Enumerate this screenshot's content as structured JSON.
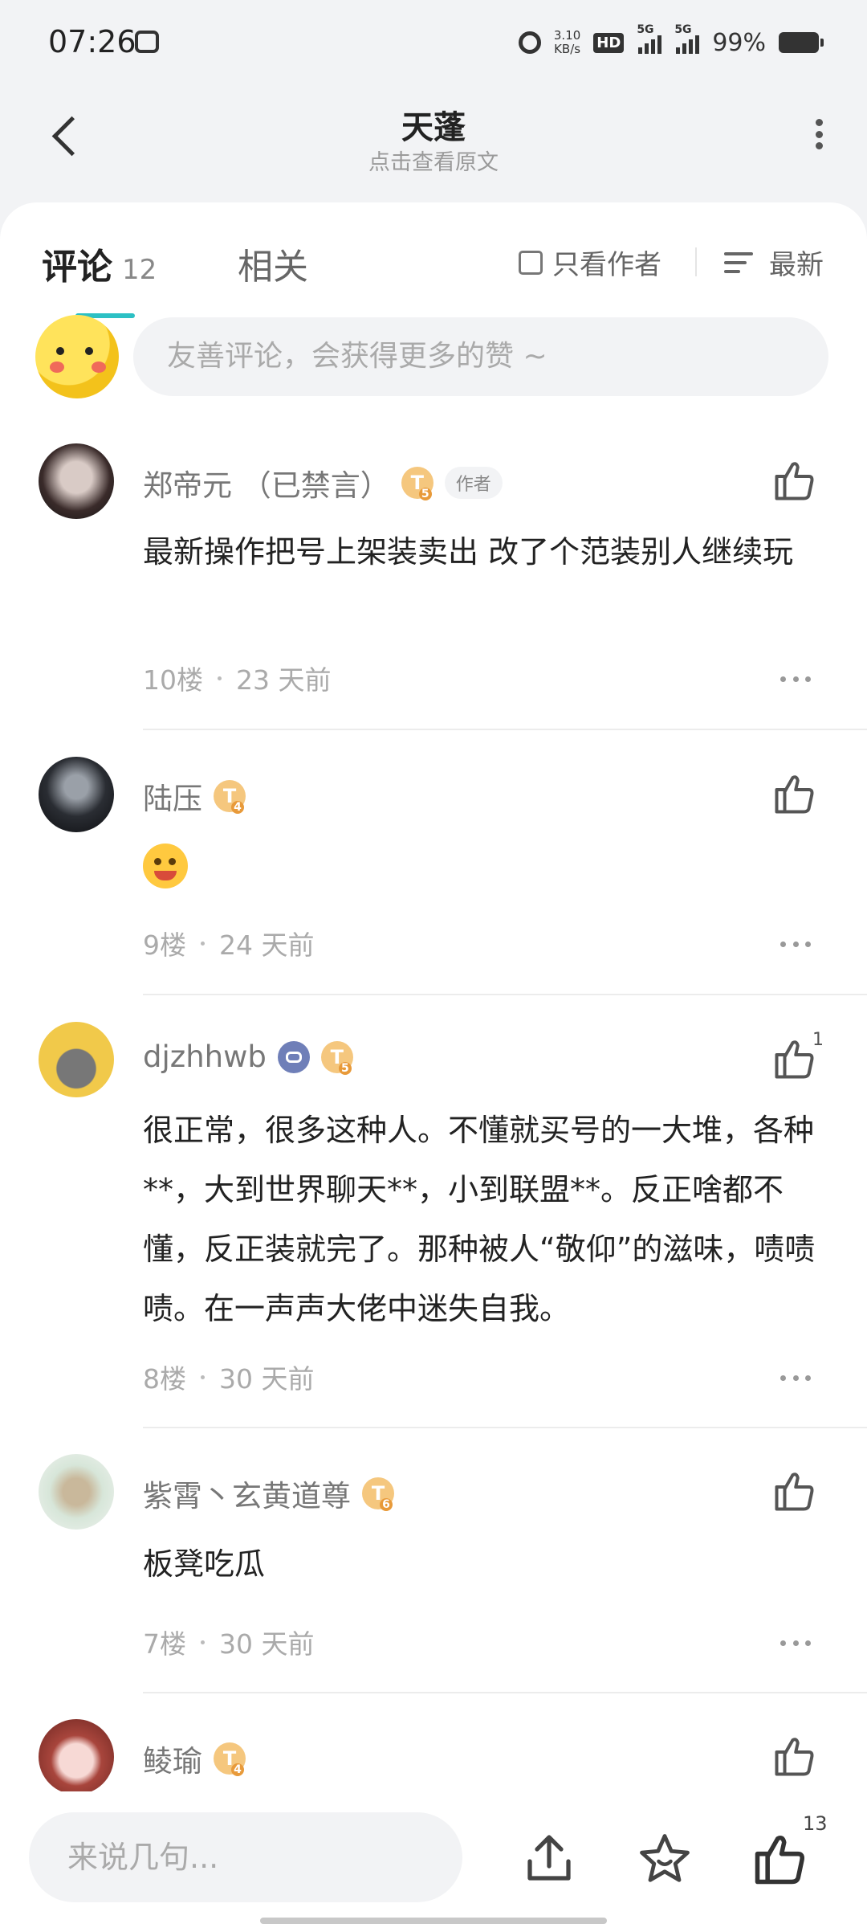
{
  "status_bar": {
    "time": "07:26",
    "net_speed_value": "3.10",
    "net_speed_unit": "KB/s",
    "hd": "HD",
    "sig1": "5G",
    "sig2": "5G",
    "battery": "99%"
  },
  "header": {
    "title": "天蓬",
    "subtitle": "点击查看原文"
  },
  "tabs": {
    "comments_label": "评论",
    "comments_count": "12",
    "related_label": "相关",
    "author_only": "只看作者",
    "sort": "最新"
  },
  "composer": {
    "placeholder": "友善评论，会获得更多的赞 ~"
  },
  "comments": [
    {
      "name": "郑帝元 （已禁言）",
      "level": "5",
      "author_badge": "作者",
      "text": "最新操作把号上架装卖出 改了个范装别人继续玩",
      "floor": "10楼",
      "time": "23 天前"
    },
    {
      "name": "陆压",
      "level": "4",
      "floor": "9楼",
      "time": "24 天前"
    },
    {
      "name": "djzhhwb",
      "level": "5",
      "likes": "1",
      "text": "很正常，很多这种人。不懂就买号的一大堆，各种**，大到世界聊天**，小到联盟**。反正啥都不懂，反正装就完了。那种被人“敬仰”的滋味，啧啧啧。在一声声大佬中迷失自我。",
      "floor": "8楼",
      "time": "30 天前"
    },
    {
      "name": "紫霄丶玄黄道尊",
      "level": "6",
      "text": "板凳吃瓜",
      "floor": "7楼",
      "time": "30 天前"
    },
    {
      "name": "鲮瑜",
      "level": "4"
    }
  ],
  "bottom_bar": {
    "reply_placeholder": "来说几句...",
    "like_count": "13"
  }
}
